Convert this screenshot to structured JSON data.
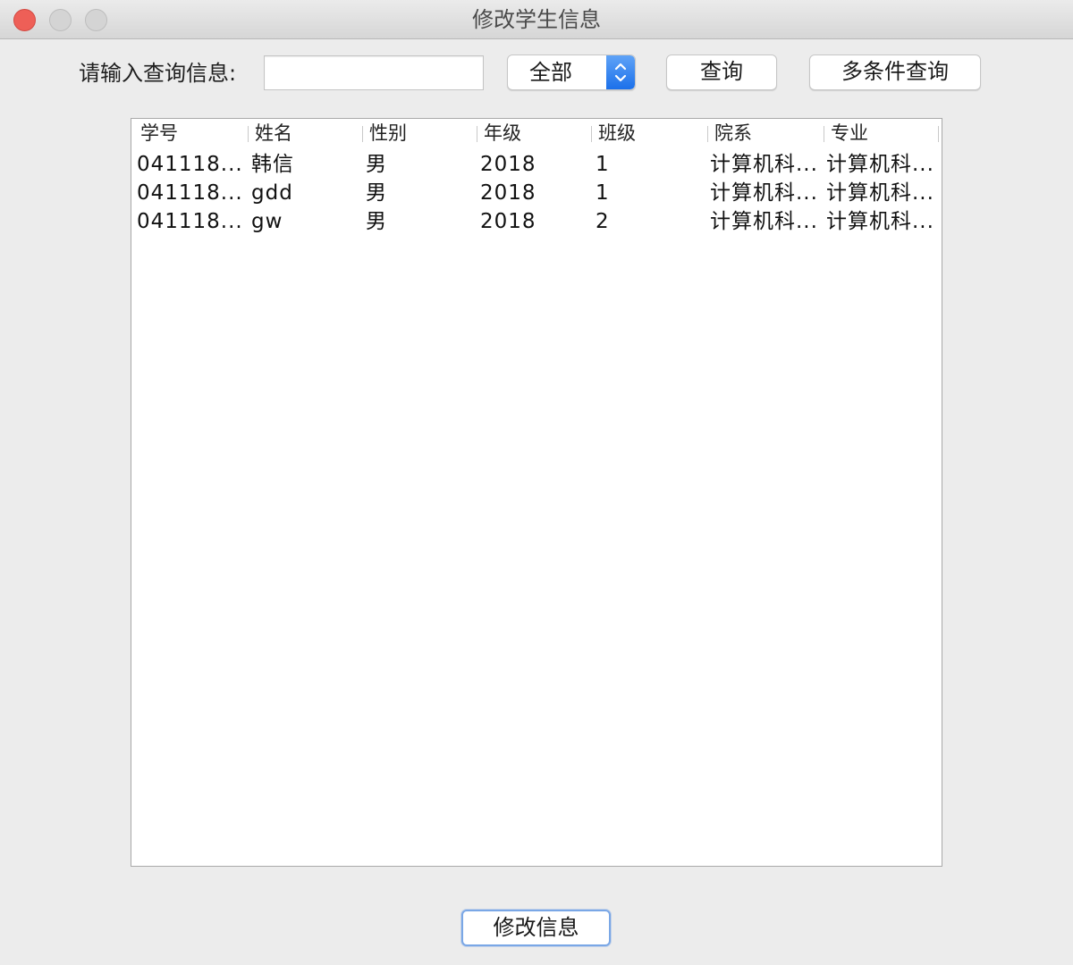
{
  "window": {
    "title": "修改学生信息"
  },
  "search": {
    "label": "请输入查询信息:",
    "value": "",
    "placeholder": ""
  },
  "filter": {
    "selected": "全部"
  },
  "buttons": {
    "query": "查询",
    "multi_query": "多条件查询",
    "modify": "修改信息"
  },
  "table": {
    "columns": [
      "学号",
      "姓名",
      "性别",
      "年级",
      "班级",
      "院系",
      "专业"
    ],
    "rows": [
      [
        "041118...",
        "韩信",
        "男",
        "2018",
        "1",
        "计算机科...",
        "计算机科..."
      ],
      [
        "041118...",
        "gdd",
        "男",
        "2018",
        "1",
        "计算机科...",
        "计算机科..."
      ],
      [
        "041118...",
        "gw",
        "男",
        "2018",
        "2",
        "计算机科...",
        "计算机科..."
      ]
    ]
  },
  "colors": {
    "close": "#ee5f57",
    "select_accent": "#1b70ea",
    "focus_ring": "#7aa7e6"
  },
  "icons": {
    "select_arrows": "chevron-up-down-icon"
  }
}
